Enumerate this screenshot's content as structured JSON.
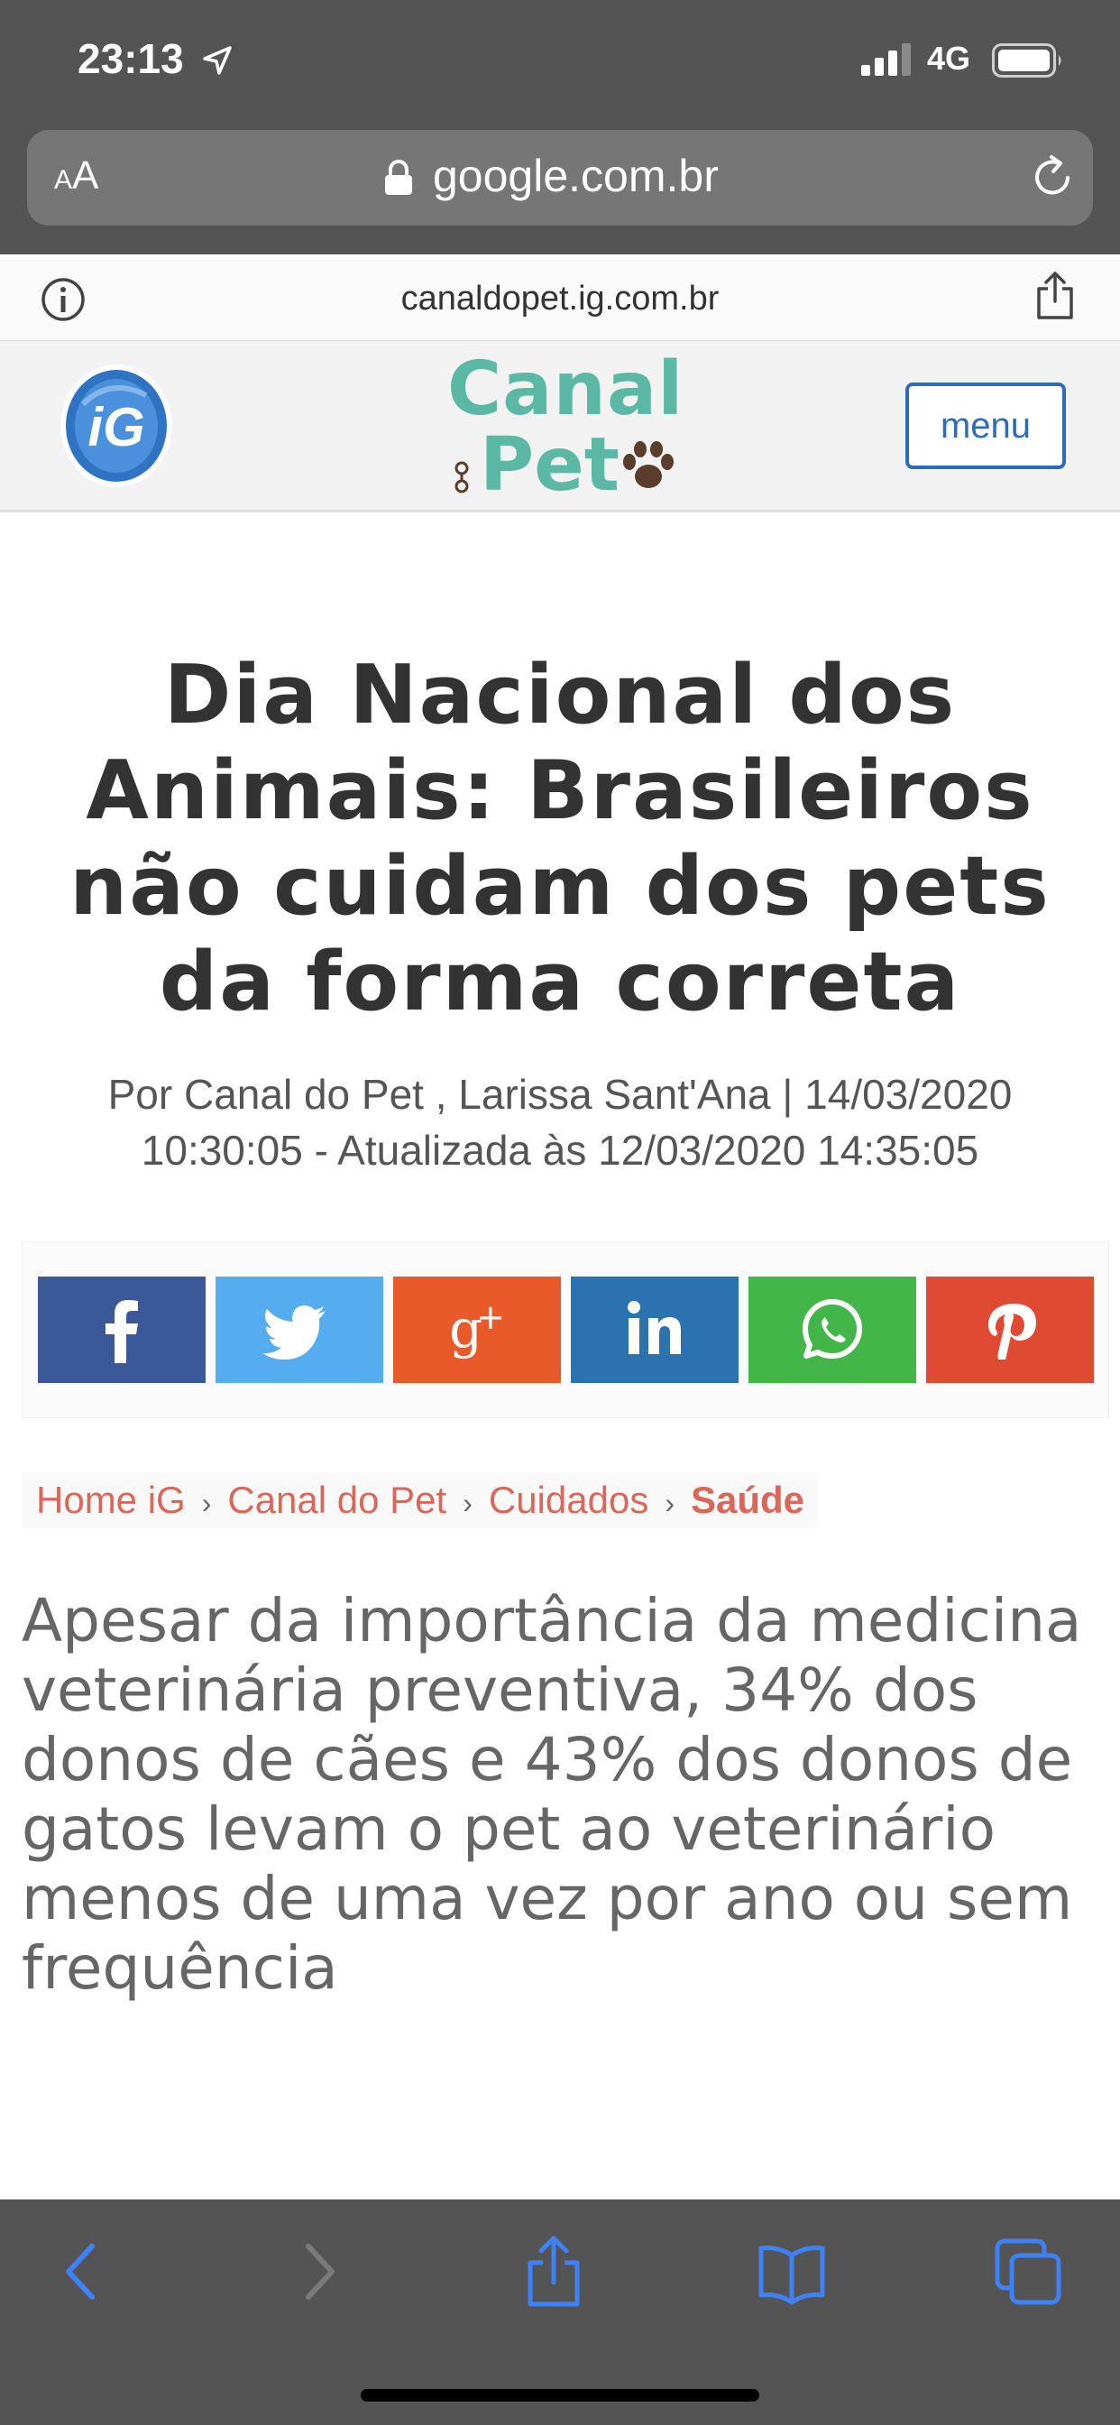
{
  "status_bar": {
    "time": "23:13",
    "network": "4G"
  },
  "browser": {
    "aa_small": "A",
    "aa_big": "A",
    "url": "google.com.br",
    "site_domain": "canaldopet.ig.com.br"
  },
  "site": {
    "ig_logo_text": "iG",
    "brand_line1": "Canal",
    "brand_line2": "Pet",
    "menu_label": "menu"
  },
  "article": {
    "headline": "Dia Nacional dos Animais: Brasileiros não cuidam dos pets da forma correta",
    "byline_prefix": "Por ",
    "byline_authors": "Canal do Pet , Larissa Sant'Ana",
    "byline_dates": " | 14/03/2020 10:30:05 - Atualizada às 12/03/2020 14:35:05",
    "lead": "Apesar da importância da medicina veterinária preventiva, 34% dos donos de cães e 43% dos donos de gatos levam o pet ao veterinário menos de uma vez por ano ou sem frequência"
  },
  "share_buttons": [
    {
      "network": "facebook",
      "icon": "facebook-icon",
      "color": "#3b5998"
    },
    {
      "network": "twitter",
      "icon": "twitter-icon",
      "color": "#55acee"
    },
    {
      "network": "google-plus",
      "icon": "google-plus-icon",
      "color": "#e85a29"
    },
    {
      "network": "linkedin",
      "icon": "linkedin-icon",
      "color": "#2b73b0"
    },
    {
      "network": "whatsapp",
      "icon": "whatsapp-icon",
      "color": "#43b649"
    },
    {
      "network": "pinterest",
      "icon": "pinterest-icon",
      "color": "#df4a32"
    }
  ],
  "breadcrumb": {
    "items": [
      "Home iG",
      "Canal do Pet",
      "Cuidados"
    ],
    "current": "Saúde",
    "separator": "›"
  },
  "toolbar": {
    "icons": [
      "back-icon",
      "forward-icon",
      "share-icon",
      "bookmarks-icon",
      "tabs-icon"
    ]
  },
  "colors": {
    "chrome": "#545454",
    "brand_teal": "#5bb8a5",
    "link_red": "#d9675a",
    "menu_blue": "#2e6db5",
    "toolbar_blue": "#3d82f7"
  }
}
